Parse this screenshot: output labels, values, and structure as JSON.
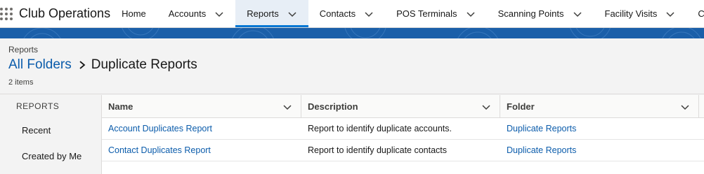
{
  "app": {
    "name": "Club Operations"
  },
  "nav": {
    "items": [
      {
        "label": "Home",
        "has_menu": false,
        "active": false
      },
      {
        "label": "Accounts",
        "has_menu": true,
        "active": false
      },
      {
        "label": "Reports",
        "has_menu": true,
        "active": true
      },
      {
        "label": "Contacts",
        "has_menu": true,
        "active": false
      },
      {
        "label": "POS Terminals",
        "has_menu": true,
        "active": false
      },
      {
        "label": "Scanning Points",
        "has_menu": true,
        "active": false
      },
      {
        "label": "Facility Visits",
        "has_menu": true,
        "active": false
      },
      {
        "label": "Cours",
        "has_menu": false,
        "active": false
      }
    ]
  },
  "header": {
    "object_label": "Reports",
    "breadcrumb_link": "All Folders",
    "current_folder": "Duplicate Reports",
    "item_count": "2 items"
  },
  "sidebar": {
    "heading": "REPORTS",
    "items": [
      "Recent",
      "Created by Me"
    ]
  },
  "table": {
    "columns": [
      "Name",
      "Description",
      "Folder"
    ],
    "rows": [
      {
        "name": "Account Duplicates Report",
        "description": "Report to identify duplicate accounts.",
        "folder": "Duplicate Reports"
      },
      {
        "name": "Contact Duplicates Report",
        "description": "Report to identify duplicate contacts",
        "folder": "Duplicate Reports"
      }
    ]
  },
  "colors": {
    "accent": "#0176d3",
    "link": "#0b5cab",
    "brand_band": "#1b5fa9"
  }
}
